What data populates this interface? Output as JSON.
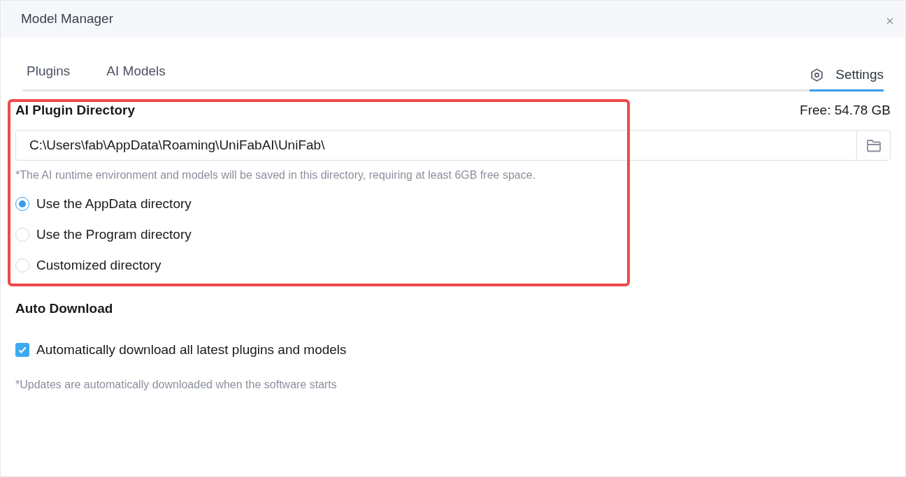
{
  "window": {
    "title": "Model Manager"
  },
  "tabs": [
    {
      "label": "Plugins",
      "selected": false,
      "kind": "plain"
    },
    {
      "label": "AI Models",
      "selected": false,
      "kind": "plain"
    },
    {
      "label": "Settings",
      "selected": true,
      "kind": "icon"
    }
  ],
  "plugin_directory": {
    "title": "AI Plugin Directory",
    "free_space": "Free: 54.78 GB",
    "path": "C:\\Users\\fab\\AppData\\Roaming\\UniFabAI\\UniFab\\",
    "note": "*The AI runtime environment and models will be saved in this directory, requiring at least 6GB free space.",
    "options": [
      {
        "label": "Use the AppData directory",
        "selected": true
      },
      {
        "label": "Use the Program directory",
        "selected": false
      },
      {
        "label": "Customized directory",
        "selected": false
      }
    ]
  },
  "auto_download": {
    "title": "Auto Download",
    "checkbox": {
      "label": "Automatically download all latest plugins and models",
      "checked": true
    },
    "note": "*Updates are automatically downloaded when the software starts"
  }
}
